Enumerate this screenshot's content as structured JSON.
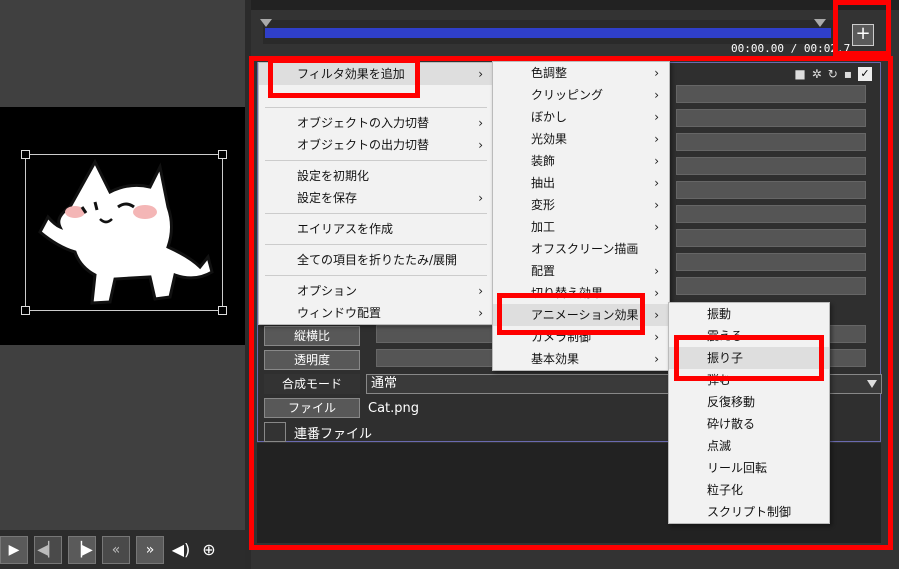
{
  "preview": {
    "transport_icons": [
      "play-icon",
      "step-back-icon",
      "step-forward-icon",
      "rewind-icon",
      "fast-forward-icon",
      "speaker-icon",
      "zoom-icon"
    ]
  },
  "timeline": {
    "timecode": "00:00.00 / 00:02.7",
    "add_button": "+"
  },
  "properties": {
    "rows": [
      {
        "label": "縦横比"
      },
      {
        "label": "透明度"
      }
    ],
    "blend_label": "合成モード",
    "blend_value": "通常",
    "file_label": "ファイル",
    "file_value": "Cat.png",
    "sequence_label": "連番ファイル"
  },
  "context_menu": {
    "items": [
      {
        "label": "フィルタ効果を追加",
        "arrow": "›"
      },
      {
        "label": "オブジェクトの入力切替",
        "arrow": "›"
      },
      {
        "label": "オブジェクトの出力切替",
        "arrow": "›"
      },
      {
        "label": "設定を初期化",
        "arrow": ""
      },
      {
        "label": "設定を保存",
        "arrow": "›"
      },
      {
        "label": "エイリアスを作成",
        "arrow": ""
      },
      {
        "label": "全ての項目を折りたたみ/展開",
        "arrow": ""
      },
      {
        "label": "オプション",
        "arrow": "›"
      },
      {
        "label": "ウィンドウ配置",
        "arrow": "›"
      }
    ]
  },
  "filter_menu": {
    "items": [
      {
        "label": "色調整",
        "arrow": "›"
      },
      {
        "label": "クリッピング",
        "arrow": "›"
      },
      {
        "label": "ぼかし",
        "arrow": "›"
      },
      {
        "label": "光効果",
        "arrow": "›"
      },
      {
        "label": "装飾",
        "arrow": "›"
      },
      {
        "label": "抽出",
        "arrow": "›"
      },
      {
        "label": "変形",
        "arrow": "›"
      },
      {
        "label": "加工",
        "arrow": "›"
      },
      {
        "label": "オフスクリーン描画",
        "arrow": ""
      },
      {
        "label": "配置",
        "arrow": "›"
      },
      {
        "label": "切り替え効果",
        "arrow": "›"
      },
      {
        "label": "アニメーション効果",
        "arrow": "›"
      },
      {
        "label": "カメラ制御",
        "arrow": "›"
      },
      {
        "label": "基本効果",
        "arrow": "›"
      }
    ]
  },
  "animation_menu": {
    "items": [
      {
        "label": "振動"
      },
      {
        "label": "震える"
      },
      {
        "label": "振り子"
      },
      {
        "label": "弾む"
      },
      {
        "label": "反復移動"
      },
      {
        "label": "砕け散る"
      },
      {
        "label": "点滅"
      },
      {
        "label": "リール回転"
      },
      {
        "label": "粒子化"
      },
      {
        "label": "スクリプト制御"
      }
    ]
  },
  "colors": {
    "highlight": "#ff0000",
    "seek_fill": "#2f3fc9"
  }
}
